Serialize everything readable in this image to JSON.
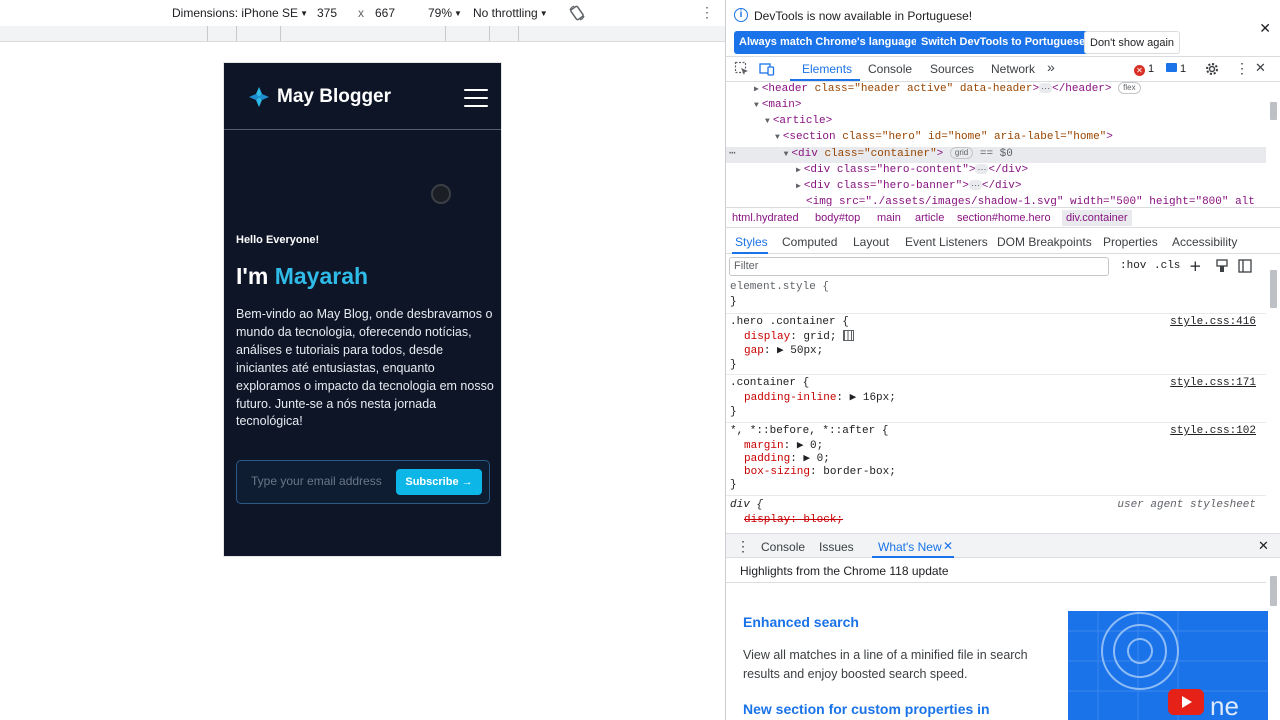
{
  "emulation": {
    "device": "Dimensions: iPhone SE",
    "width": "375",
    "times": "x",
    "height": "667",
    "zoom": "79%",
    "throttle": "No throttling"
  },
  "site": {
    "brand": "May Blogger",
    "greeting": "Hello Everyone!",
    "title_prefix": "I'm ",
    "title_name": "Mayarah",
    "description": "Bem-vindo ao May Blog, onde desbravamos o mundo da tecnologia, oferecendo notícias, análises e tutoriais para todos, desde iniciantes até entusiastas, enquanto exploramos o impacto da tecnologia em nosso futuro. Junte-se a nós nesta jornada tecnológica!",
    "email_placeholder": "Type your email address",
    "subscribe_label": "Subscribe →"
  },
  "devtools": {
    "infobar": {
      "message": "DevTools is now available in Portuguese!",
      "btn_match": "Always match Chrome's language",
      "btn_switch": "Switch DevTools to Portuguese",
      "btn_dismiss": "Don't show again"
    },
    "tabs": [
      "Elements",
      "Console",
      "Sources",
      "Network"
    ],
    "more_tabs": "»",
    "error_count": "1",
    "message_count": "1",
    "dom": {
      "l1_tag": "<header ",
      "l1_attrs": "class=\"header active\" data-header",
      "l1_end": "</header>",
      "l1_pill": "flex",
      "l2": "<main>",
      "l3": "<article>",
      "l4_open": "<section ",
      "l4_attrs": "class=\"hero\" id=\"home\" aria-label=\"home\"",
      "l4_close": ">",
      "l5_open": "<div ",
      "l5_attrs": "class=\"container\"",
      "l5_close": ">",
      "l5_pill": "grid",
      "l5_ref": "== $0",
      "l6": "<div class=\"hero-content\">",
      "l6_end": "</div>",
      "l7": "<div class=\"hero-banner\">",
      "l7_end": "</div>",
      "l8": "<img src=\"./assets/images/shadow-1.svg\" width=\"500\" height=\"800\" alt"
    },
    "breadcrumbs": [
      "html.hydrated",
      "body#top",
      "main",
      "article",
      "section#home.hero",
      "div.container"
    ],
    "subtabs": [
      "Styles",
      "Computed",
      "Layout",
      "Event Listeners",
      "DOM Breakpoints",
      "Properties",
      "Accessibility"
    ],
    "filter_placeholder": "Filter",
    "hov": ":hov",
    "cls": ".cls",
    "styles": {
      "element_style": "element.style {",
      "close": "}",
      "r1_sel": ".hero .container {",
      "r1_src": "style.css:416",
      "r1_p1": "display",
      "r1_v1": "grid;",
      "r1_p2": "gap",
      "r1_v2": "▶ 50px;",
      "r2_sel": ".container {",
      "r2_src": "style.css:171",
      "r2_p1": "padding-inline",
      "r2_v1": "▶ 16px;",
      "r3_sel": "*, *::before, *::after {",
      "r3_src": "style.css:102",
      "r3_p1": "margin",
      "r3_v1": "▶ 0;",
      "r3_p2": "padding",
      "r3_v2": "▶ 0;",
      "r3_p3": "box-sizing",
      "r3_v3": "border-box;",
      "r4_sel": "div {",
      "r4_src": "user agent stylesheet",
      "r4_line": "display: block;"
    },
    "drawer": {
      "tabs": [
        "Console",
        "Issues",
        "What's New"
      ],
      "highlights": "Highlights from the Chrome 118 update",
      "h1": "Enhanced search",
      "p1": "View all matches in a line of a minified file in search results and enjoy boosted search speed.",
      "h2": "New section for custom properties in",
      "promo_text": "ne"
    }
  }
}
